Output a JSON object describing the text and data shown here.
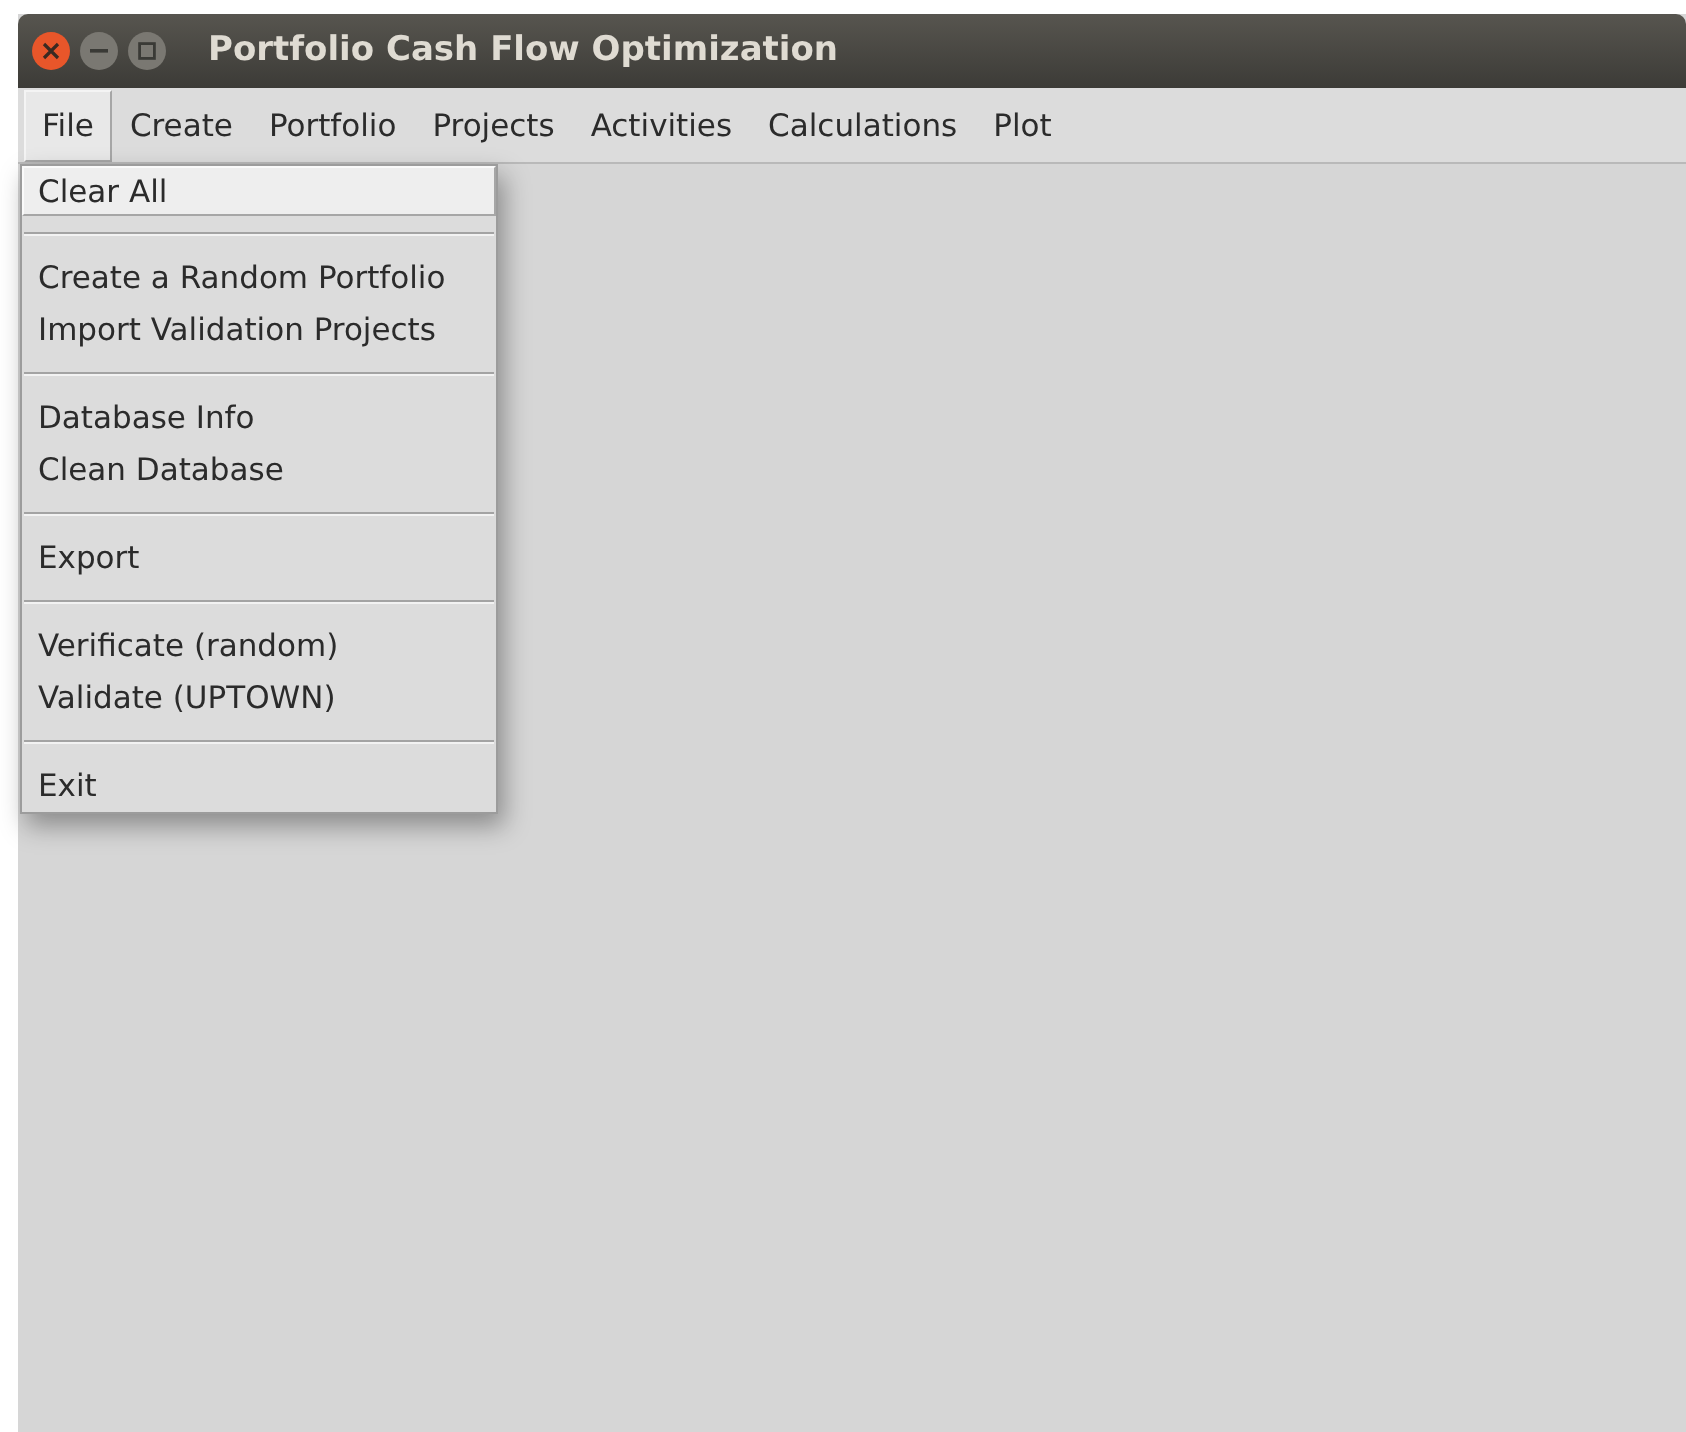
{
  "window": {
    "title": "Portfolio Cash Flow Optimization"
  },
  "menubar": [
    {
      "label": "File",
      "selected": true
    },
    {
      "label": "Create",
      "selected": false
    },
    {
      "label": "Portfolio",
      "selected": false
    },
    {
      "label": "Projects",
      "selected": false
    },
    {
      "label": "Activities",
      "selected": false
    },
    {
      "label": "Calculations",
      "selected": false
    },
    {
      "label": "Plot",
      "selected": false
    }
  ],
  "dropdown": [
    {
      "kind": "item",
      "label": "Clear All",
      "selected": true
    },
    {
      "kind": "separator"
    },
    {
      "kind": "item",
      "label": "Create a Random Portfolio",
      "selected": false
    },
    {
      "kind": "item",
      "label": "Import Validation Projects",
      "selected": false
    },
    {
      "kind": "separator"
    },
    {
      "kind": "item",
      "label": "Database Info",
      "selected": false
    },
    {
      "kind": "item",
      "label": "Clean Database",
      "selected": false
    },
    {
      "kind": "separator"
    },
    {
      "kind": "item",
      "label": "Export",
      "selected": false
    },
    {
      "kind": "separator"
    },
    {
      "kind": "item",
      "label": "Verificate (random)",
      "selected": false
    },
    {
      "kind": "item",
      "label": "Validate (UPTOWN)",
      "selected": false
    },
    {
      "kind": "separator"
    },
    {
      "kind": "item",
      "label": "Exit",
      "selected": false
    }
  ]
}
